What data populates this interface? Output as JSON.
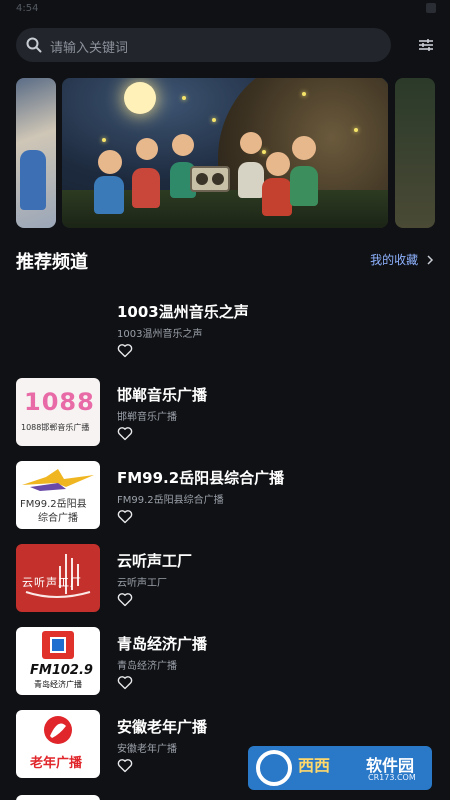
{
  "status": {
    "time": "4:54"
  },
  "search": {
    "placeholder": "请输入关键词"
  },
  "section": {
    "title": "推荐频道",
    "favorites_link": "我的收藏"
  },
  "channels": [
    {
      "title": "1003温州音乐之声",
      "subtitle": "1003温州音乐之声",
      "thumb_text": ""
    },
    {
      "title": "邯郸音乐广播",
      "subtitle": "邯郸音乐广播",
      "thumb_text": "1088邯郸音乐广播",
      "thumb_big": "1088"
    },
    {
      "title": "FM99.2岳阳县综合广播",
      "subtitle": "FM99.2岳阳县综合广播",
      "thumb_line1": "FM99.2岳阳县",
      "thumb_line2": "综合广播"
    },
    {
      "title": "云听声工厂",
      "subtitle": "云听声工厂",
      "thumb_text": "云听声工厂"
    },
    {
      "title": "青岛经济广播",
      "subtitle": "青岛经济广播",
      "thumb_fm": "FM102.9",
      "thumb_text": "青岛经济广播"
    },
    {
      "title": "安徽老年广播",
      "subtitle": "安徽老年广播",
      "thumb_text": "老年广播"
    }
  ],
  "watermark": {
    "brand1": "西西",
    "brand2": "软件园",
    "domain": "CR173.COM"
  },
  "colors": {
    "background": "#0f1114",
    "accent_link": "#8fb3ff",
    "search_bg": "#22252c"
  },
  "icons": [
    "search-icon",
    "filter-icon",
    "chevron-right-icon",
    "heart-icon"
  ]
}
